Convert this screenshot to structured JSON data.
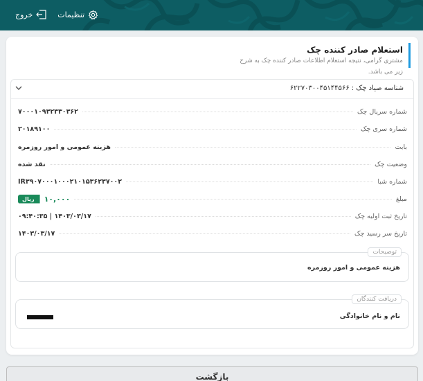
{
  "topbar": {
    "settings_label": "تنظیمات",
    "logout_label": "خروج",
    "bg_color": "#0d5d63"
  },
  "header": {
    "title": "استعلام صادر کننده چک",
    "subtitle": "مشتری گرامی، نتیجه استعلام اطلاعات صادر کننده چک به شرح زیر می باشد."
  },
  "panel": {
    "sayad_label": "شناسه صیاد چک : ۶۲۲۷۰۳۰۰۴۵۱۴۴۵۶۶",
    "rows": [
      {
        "label": "شماره سریال چک",
        "value": "۷۰۰۰۱۰۹۳۲۳۳۰۳۶۲"
      },
      {
        "label": "شماره سری چک",
        "value": "۲۰۱۸۹۱۰۰"
      },
      {
        "label": "بابت",
        "value": "هزینه عمومی و امور روزمره"
      },
      {
        "label": "وضعیت چک",
        "value": "نقد شده"
      },
      {
        "label": "شماره شبا",
        "value": "IR۳۹۰۷۰۰۰۱۰۰۰۲۱۰۱۵۳۶۲۳۷۰۰۲"
      },
      {
        "label": "مبلغ",
        "value": "۱۰,۰۰۰",
        "badge": "ریال"
      },
      {
        "label": "تاریخ ثبت اولیه چک",
        "value": "۱۴۰۳/۰۳/۱۷ | ۰۹:۴۰:۳۵"
      },
      {
        "label": "تاریخ سر رسید چک",
        "value": "۱۴۰۳/۰۳/۱۷"
      }
    ]
  },
  "description": {
    "legend": "توضیحات",
    "text": "هزینه عمومی و امور روزمره"
  },
  "receivers": {
    "legend": "دریافت کنندگان",
    "name_label": "نام و نام خانوادگی"
  },
  "back_button": "بازگشت",
  "colors": {
    "accent": "#1e9ae0",
    "amount": "#1a8a5a"
  }
}
